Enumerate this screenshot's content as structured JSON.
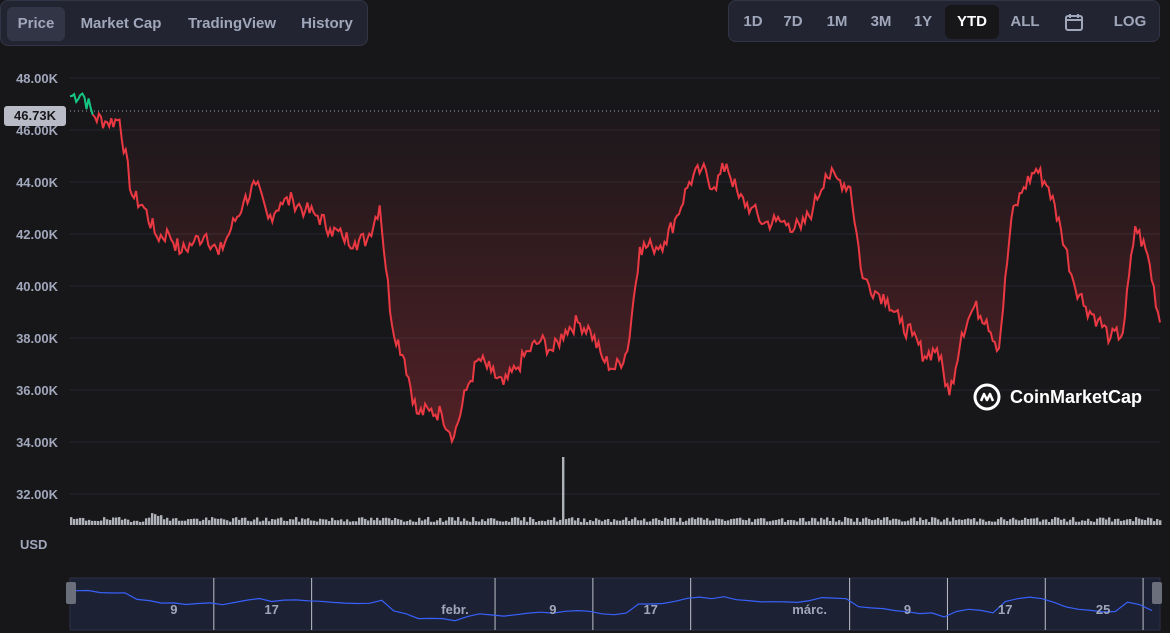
{
  "tabs": {
    "price": "Price",
    "market_cap": "Market Cap",
    "tradingview": "TradingView",
    "history": "History"
  },
  "ranges": {
    "d1": "1D",
    "d7": "7D",
    "m1": "1M",
    "m3": "3M",
    "y1": "1Y",
    "ytd": "YTD",
    "all": "ALL",
    "log": "LOG"
  },
  "icons": {
    "calendar": "calendar-icon",
    "logo": "coinmarketcap-logo-icon"
  },
  "colors": {
    "up": "#16c784",
    "down": "#ea3943",
    "navigator_line": "#3861fb",
    "volume": "#c9ccd4"
  },
  "currency": "USD",
  "current_price_label": "46.73K",
  "brand": "CoinMarketCap",
  "chart_data": {
    "type": "line",
    "title": "",
    "xlabel": "",
    "ylabel": "",
    "ylim": [
      31000,
      48500
    ],
    "xlim_days": "2024-01-01 to 2024-03-29",
    "y_ticks": [
      "48.00K",
      "46.00K",
      "44.00K",
      "42.00K",
      "40.00K",
      "38.00K",
      "36.00K",
      "34.00K",
      "32.00K"
    ],
    "x_ticks": [
      "9",
      "17",
      "febr.",
      "9",
      "17",
      "márc.",
      "9",
      "17",
      "25"
    ],
    "baseline": 46730,
    "series": [
      {
        "values": [
          {
            "date": "2024-01-01",
            "price": 47300
          },
          {
            "date": "2024-01-02",
            "price": 47400
          },
          {
            "date": "2024-01-03",
            "price": 46500
          },
          {
            "date": "2024-01-04",
            "price": 46300
          },
          {
            "date": "2024-01-05",
            "price": 46400
          },
          {
            "date": "2024-01-06",
            "price": 43500
          },
          {
            "date": "2024-01-07",
            "price": 43000
          },
          {
            "date": "2024-01-08",
            "price": 41900
          },
          {
            "date": "2024-01-09",
            "price": 42000
          },
          {
            "date": "2024-01-10",
            "price": 41300
          },
          {
            "date": "2024-01-11",
            "price": 41700
          },
          {
            "date": "2024-01-12",
            "price": 42000
          },
          {
            "date": "2024-01-13",
            "price": 41200
          },
          {
            "date": "2024-01-14",
            "price": 42200
          },
          {
            "date": "2024-01-15",
            "price": 43200
          },
          {
            "date": "2024-01-16",
            "price": 43900
          },
          {
            "date": "2024-01-17",
            "price": 42600
          },
          {
            "date": "2024-01-18",
            "price": 43200
          },
          {
            "date": "2024-01-19",
            "price": 43300
          },
          {
            "date": "2024-01-20",
            "price": 42900
          },
          {
            "date": "2024-01-21",
            "price": 42700
          },
          {
            "date": "2024-01-22",
            "price": 42200
          },
          {
            "date": "2024-01-23",
            "price": 41900
          },
          {
            "date": "2024-01-24",
            "price": 41700
          },
          {
            "date": "2024-01-25",
            "price": 41800
          },
          {
            "date": "2024-01-26",
            "price": 43100
          },
          {
            "date": "2024-01-27",
            "price": 38500
          },
          {
            "date": "2024-01-28",
            "price": 37200
          },
          {
            "date": "2024-01-29",
            "price": 35100
          },
          {
            "date": "2024-01-30",
            "price": 35200
          },
          {
            "date": "2024-01-31",
            "price": 35100
          },
          {
            "date": "2024-02-01",
            "price": 34200
          },
          {
            "date": "2024-02-02",
            "price": 36000
          },
          {
            "date": "2024-02-03",
            "price": 37200
          },
          {
            "date": "2024-02-04",
            "price": 36700
          },
          {
            "date": "2024-02-05",
            "price": 36200
          },
          {
            "date": "2024-02-06",
            "price": 36800
          },
          {
            "date": "2024-02-07",
            "price": 37500
          },
          {
            "date": "2024-02-08",
            "price": 37900
          },
          {
            "date": "2024-02-09",
            "price": 37500
          },
          {
            "date": "2024-02-10",
            "price": 38300
          },
          {
            "date": "2024-02-11",
            "price": 38600
          },
          {
            "date": "2024-02-12",
            "price": 38300
          },
          {
            "date": "2024-02-13",
            "price": 37200
          },
          {
            "date": "2024-02-14",
            "price": 36800
          },
          {
            "date": "2024-02-15",
            "price": 37500
          },
          {
            "date": "2024-02-16",
            "price": 41500
          },
          {
            "date": "2024-02-17",
            "price": 41500
          },
          {
            "date": "2024-02-18",
            "price": 41700
          },
          {
            "date": "2024-02-19",
            "price": 42700
          },
          {
            "date": "2024-02-20",
            "price": 44000
          },
          {
            "date": "2024-02-21",
            "price": 44500
          },
          {
            "date": "2024-02-22",
            "price": 43800
          },
          {
            "date": "2024-02-23",
            "price": 44700
          },
          {
            "date": "2024-02-24",
            "price": 43400
          },
          {
            "date": "2024-02-25",
            "price": 43000
          },
          {
            "date": "2024-02-26",
            "price": 42400
          },
          {
            "date": "2024-02-27",
            "price": 42500
          },
          {
            "date": "2024-02-28",
            "price": 42400
          },
          {
            "date": "2024-02-29",
            "price": 42200
          },
          {
            "date": "2024-03-01",
            "price": 43000
          },
          {
            "date": "2024-03-02",
            "price": 44300
          },
          {
            "date": "2024-03-03",
            "price": 44100
          },
          {
            "date": "2024-03-04",
            "price": 43800
          },
          {
            "date": "2024-03-05",
            "price": 40300
          },
          {
            "date": "2024-03-06",
            "price": 39800
          },
          {
            "date": "2024-03-07",
            "price": 39500
          },
          {
            "date": "2024-03-08",
            "price": 38600
          },
          {
            "date": "2024-03-09",
            "price": 38100
          },
          {
            "date": "2024-03-10",
            "price": 37300
          },
          {
            "date": "2024-03-11",
            "price": 37600
          },
          {
            "date": "2024-03-12",
            "price": 35800
          },
          {
            "date": "2024-03-13",
            "price": 38200
          },
          {
            "date": "2024-03-14",
            "price": 39200
          },
          {
            "date": "2024-03-15",
            "price": 38700
          },
          {
            "date": "2024-03-16",
            "price": 37600
          },
          {
            "date": "2024-03-17",
            "price": 42600
          },
          {
            "date": "2024-03-18",
            "price": 43800
          },
          {
            "date": "2024-03-19",
            "price": 44500
          },
          {
            "date": "2024-03-20",
            "price": 43800
          },
          {
            "date": "2024-03-21",
            "price": 42200
          },
          {
            "date": "2024-03-22",
            "price": 40200
          },
          {
            "date": "2024-03-23",
            "price": 39200
          },
          {
            "date": "2024-03-24",
            "price": 38700
          },
          {
            "date": "2024-03-25",
            "price": 38000
          },
          {
            "date": "2024-03-26",
            "price": 38200
          },
          {
            "date": "2024-03-27",
            "price": 42300
          },
          {
            "date": "2024-03-28",
            "price": 41200
          },
          {
            "date": "2024-03-29",
            "price": 38600
          }
        ]
      }
    ]
  }
}
